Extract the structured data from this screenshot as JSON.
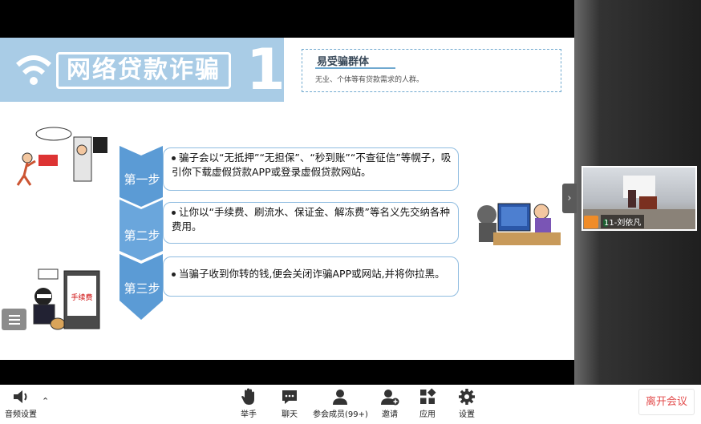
{
  "slide": {
    "banner_title": "网络贷款诈骗",
    "banner_number": "1",
    "vulnerable": {
      "heading": "易受骗群体",
      "text": "无业、个体等有贷款需求的人群。"
    },
    "steps": [
      {
        "label": "第一步",
        "text": "骗子会以“无抵押”“无担保”、“秒到账”“不查征信”等幌子，吸引你下载虚假贷款APP或登录虚假贷款网站。"
      },
      {
        "label": "第二步",
        "text": "让你以“手续费、刷流水、保证金、解冻费”等名义先交纳各种费用。"
      },
      {
        "label": "第三步",
        "text": "当骗子收到你转的钱,便会关闭诈骗APP或网站,并将你拉黑。"
      }
    ],
    "illus_sign": "手续费"
  },
  "participant": {
    "name": "11-刘依凡"
  },
  "toolbar": {
    "audio_label": "音频设置",
    "raise_hand_label": "举手",
    "chat_label": "聊天",
    "members_label": "参会成员(99+)",
    "invite_label": "邀请",
    "apps_label": "应用",
    "settings_label": "设置",
    "leave_label": "离开会议"
  },
  "colors": {
    "accent_blue": "#5b9bd5",
    "leave_red": "#e34d4d",
    "speaking_green": "#3cd36c"
  }
}
